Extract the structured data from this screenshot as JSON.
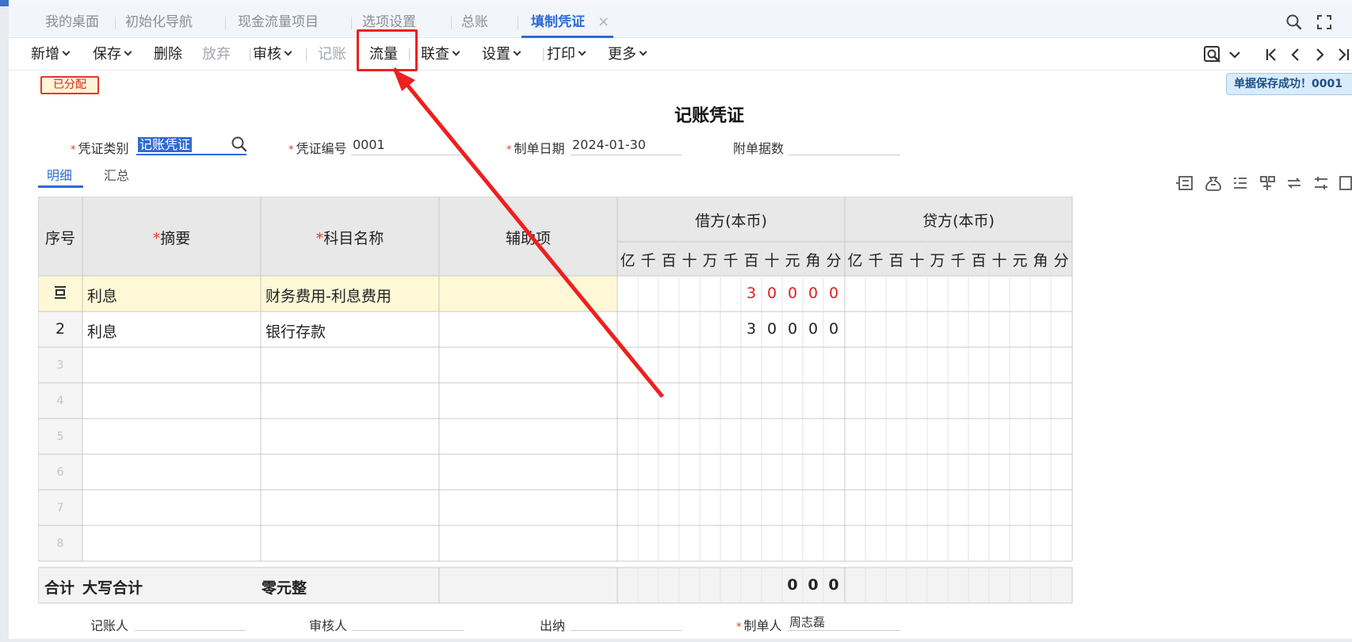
{
  "tabs": {
    "items": [
      {
        "label": "我的桌面"
      },
      {
        "label": "初始化导航"
      },
      {
        "label": "现金流量项目"
      },
      {
        "label": "选项设置"
      },
      {
        "label": "总账"
      },
      {
        "label": "填制凭证",
        "active": true
      }
    ],
    "close_glyph": "×"
  },
  "toolbar": {
    "new": "新增",
    "save": "保存",
    "delete": "删除",
    "discard": "放弃",
    "audit": "审核",
    "post": "记账",
    "cashflow": "流量",
    "linked_query": "联查",
    "settings": "设置",
    "print": "打印",
    "more": "更多"
  },
  "status": {
    "assigned_badge": "已分配",
    "toast": "单据保存成功！0001"
  },
  "voucher": {
    "title": "记账凭证",
    "category_label": "凭证类别",
    "category_value": "记账凭证",
    "number_label": "凭证编号",
    "number_value": "0001",
    "date_label": "制单日期",
    "date_value": "2024-01-30",
    "attachments_label": "附单据数",
    "attachments_value": ""
  },
  "subtabs": {
    "detail": "明细",
    "summary": "汇总"
  },
  "grid": {
    "headers": {
      "seq": "序号",
      "summary": "摘要",
      "account": "科目名称",
      "auxiliary": "辅助项",
      "debit": "借方(本币)",
      "credit": "贷方(本币)"
    },
    "required_mark": "*",
    "digit_units": [
      "亿",
      "千",
      "百",
      "十",
      "万",
      "千",
      "百",
      "十",
      "元",
      "角",
      "分"
    ],
    "rows": [
      {
        "seq": "",
        "summary": "利息",
        "account": "财务费用-利息费用",
        "auxiliary": "",
        "debit_digits": [
          "",
          "",
          "",
          "",
          "",
          "",
          "3",
          "0",
          "0",
          "0",
          "0"
        ],
        "credit_digits": [
          "",
          "",
          "",
          "",
          "",
          "",
          "",
          "",
          "",
          "",
          ""
        ],
        "selected": true
      },
      {
        "seq": "2",
        "summary": "利息",
        "account": "银行存款",
        "auxiliary": "",
        "debit_digits": [
          "",
          "",
          "",
          "",
          "",
          "",
          "3",
          "0",
          "0",
          "0",
          "0"
        ],
        "credit_digits": [
          "",
          "",
          "",
          "",
          "",
          "",
          "",
          "",
          "",
          "",
          ""
        ]
      },
      {
        "seq": "3"
      },
      {
        "seq": "4"
      },
      {
        "seq": "5"
      },
      {
        "seq": "6"
      },
      {
        "seq": "7"
      },
      {
        "seq": "8"
      }
    ],
    "total": {
      "label": "合计",
      "uppercase_label": "大写合计",
      "uppercase_value": "零元整",
      "debit_digits": [
        "",
        "",
        "",
        "",
        "",
        "",
        "",
        "",
        "0",
        "0",
        "0"
      ]
    }
  },
  "signatures": {
    "bookkeeper": "记账人",
    "bookkeeper_value": "",
    "reviewer": "审核人",
    "reviewer_value": "",
    "cashier": "出纳",
    "cashier_value": "",
    "preparer": "制单人",
    "preparer_value": "周志磊"
  },
  "colors": {
    "accent": "#2f6bd3",
    "annotation_red": "#ee2020",
    "selected_row": "#fff8d6",
    "header_bg": "#e8e8e8"
  },
  "icons": {
    "search": "search-icon",
    "fullscreen": "fullscreen-icon",
    "preview": "preview-icon",
    "first": "first-record-icon",
    "prev": "prev-record-icon",
    "next": "next-record-icon",
    "last": "last-record-icon",
    "row_insert": "row-insert-icon"
  }
}
